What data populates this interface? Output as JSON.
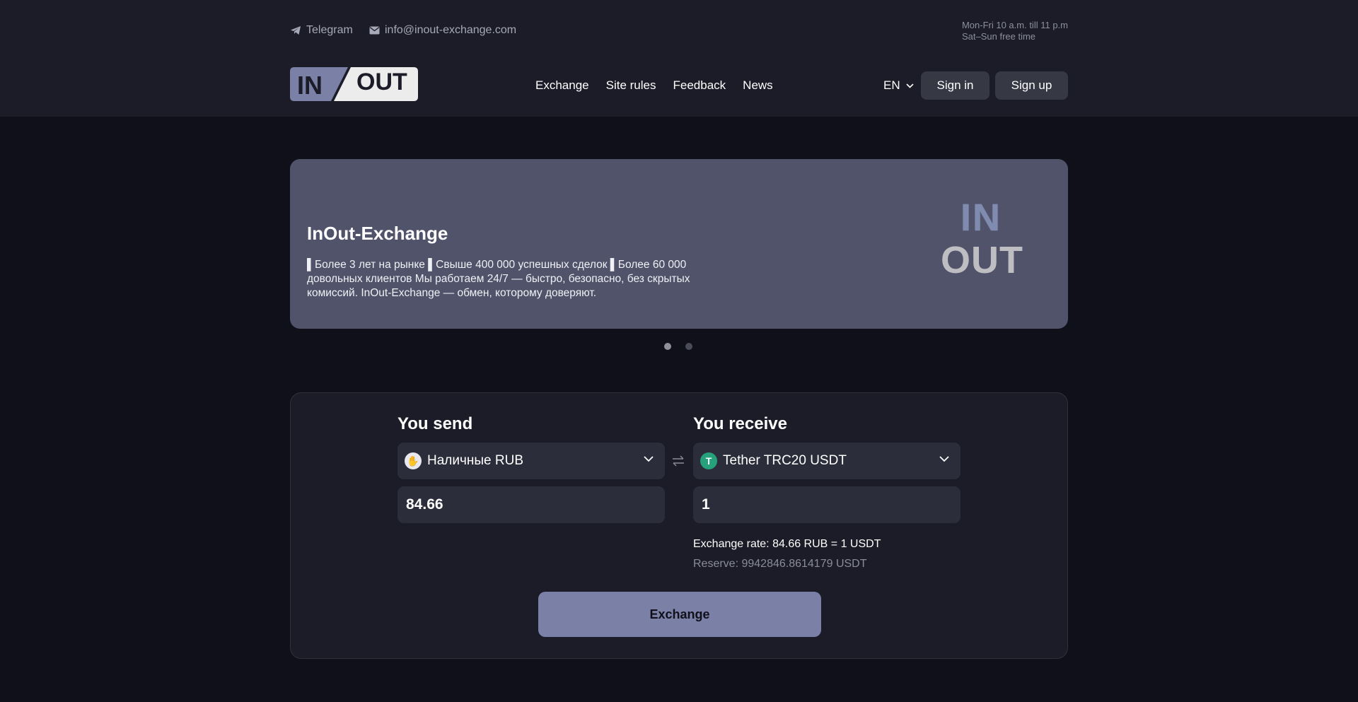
{
  "header": {
    "telegram_label": "Telegram",
    "email_label": "info@inout-exchange.com",
    "hours_line1": "Mon-Fri 10 a.m. till 11 p.m",
    "hours_line2": "Sat–Sun free time",
    "logo": {
      "left_text": "IN",
      "right_text": "OUT"
    },
    "nav": [
      "Exchange",
      "Site rules",
      "Feedback",
      "News"
    ],
    "language": "EN",
    "sign_in": "Sign in",
    "sign_up": "Sign up"
  },
  "banner": {
    "title": "InOut-Exchange",
    "text": "▌Более 3 лет на рынке ▌Свыше 400 000 успешных сделок ▌Более 60 000 довольных клиентов Мы работаем 24/7 — быстро, безопасно, без скрытых комиссий. InOut-Exchange — обмен, которому доверяют.",
    "logo_in": "IN",
    "logo_out": "OUT",
    "slides_total": 2,
    "active_slide": 1
  },
  "exchange": {
    "send_title": "You send",
    "receive_title": "You receive",
    "send_currency": "Наличные RUB",
    "receive_currency": "Tether TRC20 USDT",
    "send_amount": "84.66",
    "receive_amount": "1",
    "rate_text": "Exchange rate: 84.66 RUB = 1 USDT",
    "reserve_text": "Reserve: 9942846.8614179 USDT",
    "submit_label": "Exchange"
  },
  "colors": {
    "background": "#0f1019",
    "header": "#1b1c27",
    "banner": "#50536a",
    "accent_button": "#7b81a6",
    "tether_green": "#26a17b"
  },
  "icons": [
    "telegram-icon",
    "mail-icon",
    "chevron-down-icon",
    "rub-coin-icon",
    "tether-icon",
    "swap-icon"
  ]
}
